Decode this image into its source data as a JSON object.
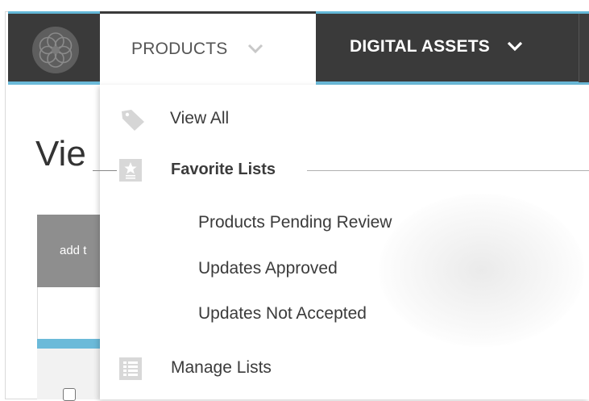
{
  "nav": {
    "products_label": "PRODUCTS",
    "digital_assets_label": "DIGITAL ASSETS"
  },
  "page": {
    "title_partial": "Vie",
    "table_header_partial": "add t"
  },
  "dropdown": {
    "view_all": "View All",
    "favorite_lists": "Favorite Lists",
    "favorites": [
      "Products Pending Review",
      "Updates Approved",
      "Updates Not Accepted"
    ],
    "manage_lists": "Manage Lists"
  },
  "icons": {
    "logo": "flower-logo-icon",
    "products_chevron": "chevron-down-icon",
    "digital_chevron": "chevron-down-icon",
    "view_all": "tag-icon",
    "favorite_lists": "star-list-icon",
    "manage_lists": "list-icon"
  },
  "colors": {
    "nav_bg": "#3a3a3a",
    "accent": "#6bbad9",
    "nav_active_bg": "#ffffff",
    "text": "#3b3b3b"
  }
}
